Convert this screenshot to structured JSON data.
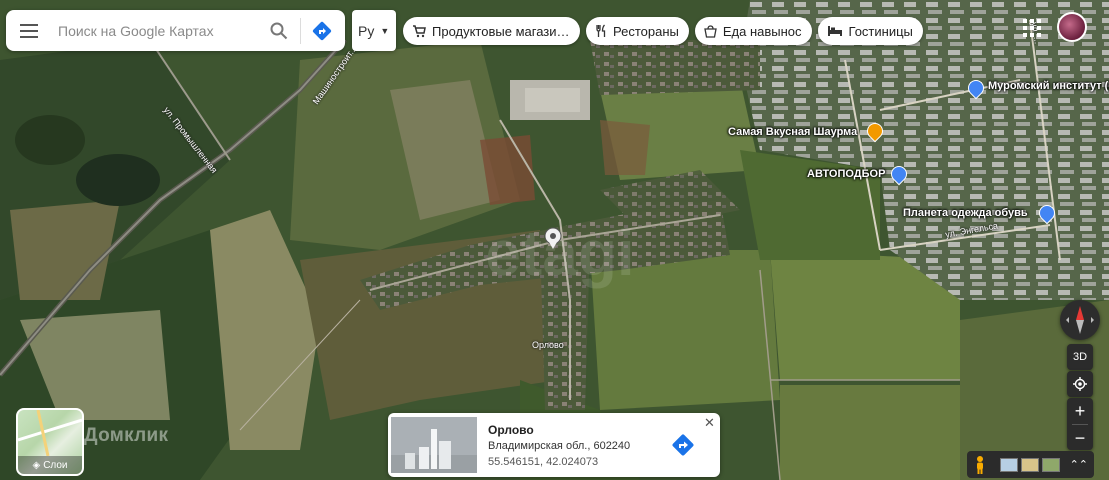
{
  "search": {
    "placeholder": "Поиск на Google Картах"
  },
  "language": {
    "value": "Ру"
  },
  "chips": [
    {
      "label": "Продуктовые магазины"
    },
    {
      "label": "Рестораны"
    },
    {
      "label": "Еда навынос"
    },
    {
      "label": "Гостиницы"
    }
  ],
  "map": {
    "pois": [
      {
        "name": "Муромский институт (филиал)"
      },
      {
        "name": "Самая Вкусная Шаурма"
      },
      {
        "name": "АВТОПОДБОР"
      },
      {
        "name": "Планета одежда обувь"
      }
    ],
    "roads": [
      {
        "name": "ул. Промышленная"
      },
      {
        "name": "Машиностроит..."
      },
      {
        "name": "ул. Энгельса"
      },
      {
        "name": "Орлово"
      },
      {
        "name": "ул. ..."
      }
    ],
    "watermark": "Домклик"
  },
  "layers": {
    "label": "Слои"
  },
  "info_card": {
    "title": "Орлово",
    "address": "Владимирская обл., 602240",
    "coords": "55.546151, 42.024073"
  },
  "controls": {
    "three_d": "3D",
    "zoom_in": "+",
    "zoom_out": "−"
  },
  "colors": {
    "accent": "#1a73e8",
    "poi_blue": "#4285f4",
    "poi_orange": "#f29900"
  }
}
